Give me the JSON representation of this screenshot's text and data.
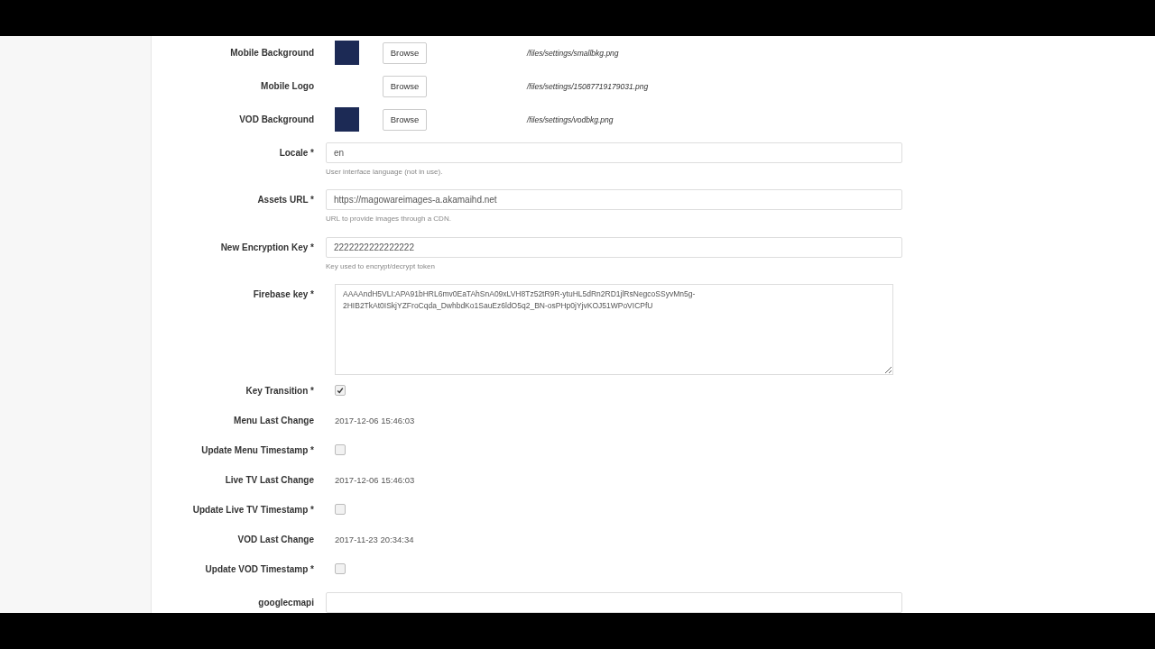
{
  "fields": [
    {
      "kind": "image",
      "label": "Mobile Background",
      "thumbnail": true,
      "button": "Browse",
      "path": "/files/settings/smallbkg.png"
    },
    {
      "kind": "image",
      "label": "Mobile Logo",
      "thumbnail": false,
      "button": "Browse",
      "path": "/files/settings/15087719179031.png"
    },
    {
      "kind": "image",
      "label": "VOD Background",
      "thumbnail": true,
      "button": "Browse",
      "path": "/files/settings/vodbkg.png"
    },
    {
      "kind": "text",
      "label": "Locale *",
      "value": "en",
      "help": "User interface language (not in use)."
    },
    {
      "kind": "text",
      "label": "Assets URL *",
      "value": "https://magowareimages-a.akamaihd.net",
      "help": "URL to provide images through a CDN."
    },
    {
      "kind": "text",
      "label": "New Encryption Key *",
      "value": "2222222222222222",
      "help": "Key used to encrypt/decrypt token"
    },
    {
      "kind": "textarea",
      "label": "Firebase key *",
      "value": "AAAAndH5VLI:APA91bHRL6mv0EaTAhSnA09xLVH8Tz52tR9R-ytuHL5dRn2RD1jlRsNegcoSSyvMn5g-2HIB2TkAt0ISkjYZFroCqda_DwhbdKo1SauEz6ldO5q2_BN-osPHp0jYjvKOJ51WPoVICPfU"
    },
    {
      "kind": "checkbox",
      "label": "Key Transition *",
      "checked": true
    },
    {
      "kind": "readonly",
      "label": "Menu Last Change",
      "value": "2017-12-06 15:46:03"
    },
    {
      "kind": "checkbox",
      "label": "Update Menu Timestamp *",
      "checked": false
    },
    {
      "kind": "readonly",
      "label": "Live TV Last Change",
      "value": "2017-12-06 15:46:03"
    },
    {
      "kind": "checkbox",
      "label": "Update Live TV Timestamp *",
      "checked": false
    },
    {
      "kind": "readonly",
      "label": "VOD Last Change",
      "value": "2017-11-23 20:34:34"
    },
    {
      "kind": "checkbox",
      "label": "Update VOD Timestamp *",
      "checked": false
    },
    {
      "kind": "text",
      "label": "googlecmapi"
    }
  ]
}
